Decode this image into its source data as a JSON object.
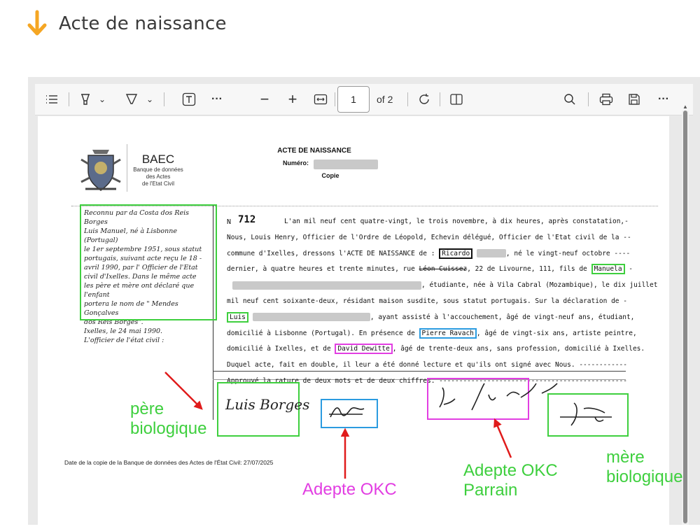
{
  "header": {
    "title": "Acte de naissance"
  },
  "toolbar": {
    "page_current": "1",
    "page_total": "of 2",
    "icons": [
      "contents-icon",
      "highlight-icon",
      "draw-icon",
      "text-icon",
      "more-icon",
      "zoom-out-icon",
      "zoom-in-icon",
      "fit-width-icon",
      "rotate-icon",
      "two-page-icon",
      "search-icon",
      "print-icon",
      "save-icon",
      "more-icon"
    ]
  },
  "document": {
    "org_name": "BAEC",
    "org_sub1": "Banque de données",
    "org_sub2": "des Actes",
    "org_sub3": "de l'Etat Civil",
    "title": "ACTE DE NAISSANCE",
    "numero_label": "Numéro:",
    "copie": "Copie",
    "number_n": "N",
    "number": "712",
    "margin_note": [
      "Reconnu par da Costa dos Reis Borges",
      "Luis Manuel, né à Lisbonne (Portugal)",
      "le 1er septembre 1951, sous statut",
      "portugais, suivant acte reçu le 18 -",
      "avril 1990, par l' Officier de l'Etat",
      "civil d'Ixelles. Dans le même acte",
      "les père et mère ont déclaré que l'enfant",
      "portera le nom de \" Mendes Gonçalves",
      "dos Reis Borges\".",
      "Ixelles, le 24 mai 1990.",
      "L'officier de l'état civil :"
    ],
    "body": {
      "l1": "L'an mil neuf cent quatre-vingt, le trois novembre, à dix heures, après constatation,-",
      "l2": "Nous, Louis Henry, Officier de l'Ordre de Léopold, Echevin délégué, Officier de l'Etat civil de la --",
      "l3a": "commune d'Ixelles, dressons l'ACTE DE NAISSANCE de : ",
      "l3name": "Ricardo",
      "l3b": ", né le vingt-neuf octobre ----",
      "l4a": "dernier, à quatre heures et trente minutes, rue ",
      "l4strike": "Léon Cuissez",
      "l4b": ", 22 de Livourne, 111, fils de ",
      "l4name": "Manuela",
      "l4c": " -",
      "l5": ", étudiante, née à Vila Cabral (Mozambique), le dix juillet",
      "l6": "mil neuf cent soixante-deux, résidant maison susdite, sous statut portugais.  Sur la déclaration de -",
      "l7name": "Luis",
      "l7": ", ayant assisté à l'accouchement, âgé de vingt-neuf ans, étudiant,",
      "l8a": "domicilié à Lisbonne (Portugal).  En présence de ",
      "l8name": "Pierre Ravach",
      "l8b": ", âgé de vingt-six ans, artiste peintre,",
      "l9a": "domicilié à Ixelles, et de ",
      "l9name": "David Dewitte",
      "l9b": ", âgé de trente-deux ans, sans profession, domicilié à Ixelles.",
      "l10": "Duquel acte, fait en double, il leur a été donné lecture et qu'ils ont signé avec Nous. ------------",
      "l11": "Approuvé la rature de deux mots et de deux chiffres. -----------------------------------------------"
    },
    "signature_pere": "Luis Borges",
    "copy_date": "Date de la copie de la Banque de données des Actes de l'État Civil: 27/07/2025"
  },
  "annotations": {
    "pere_l1": "père",
    "pere_l2": "biologique",
    "adepte1": "Adepte OKC",
    "adepte2_l1": "Adepte OKC",
    "adepte2_l2": "Parrain",
    "mere_l1": "mère",
    "mere_l2": "biologique"
  },
  "colors": {
    "accent_orange": "#f5a623",
    "green": "#3ecf3e",
    "blue": "#2b9be0",
    "magenta": "#e23ee2",
    "red": "#e01b1b"
  }
}
